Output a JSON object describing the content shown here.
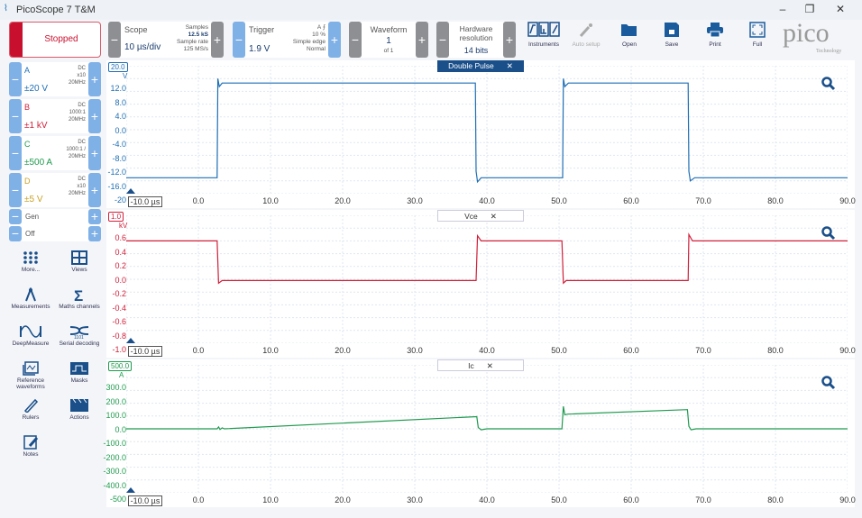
{
  "app": {
    "title": "PicoScope 7 T&M"
  },
  "toolbar": {
    "run_state": "Stopped",
    "scope": {
      "label": "Scope",
      "timebase": "10 µs/div",
      "samples_label": "Samples",
      "samples": "12.5 kS",
      "rate_label": "Sample rate",
      "rate": "125 MS/s"
    },
    "trigger": {
      "label": "Trigger",
      "level": "1.9 V",
      "source": "A",
      "position": "10 %",
      "type": "Simple edge",
      "mode": "Normal"
    },
    "waveform": {
      "label": "Waveform",
      "value": "1",
      "of": "of 1"
    },
    "resolution": {
      "label1": "Hardware",
      "label2": "resolution",
      "value": "14 bits"
    },
    "buttons": [
      "Instruments",
      "Auto setup",
      "Open",
      "Save",
      "Print",
      "Full"
    ],
    "logo": "pico",
    "logo_sub": "Technology"
  },
  "channels": [
    {
      "name": "A",
      "range": "±20 V",
      "coupling": "DC",
      "probe": "x10",
      "bw": "20MHz",
      "color": "#1f6fb5"
    },
    {
      "name": "B",
      "range": "±1 kV",
      "coupling": "DC",
      "probe": "1000:1",
      "bw": "20MHz",
      "color": "#d0203a"
    },
    {
      "name": "C",
      "range": "±500 A",
      "coupling": "DC",
      "probe": "1000:1 /",
      "bw": "20MHz",
      "color": "#1f9a4f"
    },
    {
      "name": "D",
      "range": "±5 V",
      "coupling": "DC",
      "probe": "x10",
      "bw": "20MHz",
      "color": "#c9a227"
    }
  ],
  "generator": {
    "label": "Gen",
    "state": "Off"
  },
  "side_tools": [
    "More...",
    "Views",
    "Measurements",
    "Maths channels",
    "DeepMeasure",
    "Serial decoding",
    "Reference waveforms",
    "Masks",
    "Rulers",
    "Actions",
    "Notes"
  ],
  "views": [
    {
      "tab": "Double Pulse",
      "unit": "V",
      "ref": "20.0",
      "color": "#1f6fb5",
      "yticks": [
        "12.0",
        "8.0",
        "4.0",
        "0.0",
        "-4.0",
        "-8.0",
        "-12.0",
        "-16.0",
        "-20"
      ],
      "ymin": -20,
      "ymax": 20,
      "points": [
        [
          -10,
          -15
        ],
        [
          2.6,
          -15
        ],
        [
          2.7,
          16
        ],
        [
          2.9,
          13.5
        ],
        [
          3.3,
          14.6
        ],
        [
          38.4,
          14.6
        ],
        [
          38.5,
          -13
        ],
        [
          38.7,
          -16.3
        ],
        [
          39.2,
          -15
        ],
        [
          50.5,
          -15
        ],
        [
          50.6,
          16
        ],
        [
          50.8,
          13.5
        ],
        [
          51.3,
          14.6
        ],
        [
          67.9,
          14.6
        ],
        [
          68,
          -13
        ],
        [
          68.2,
          -16
        ],
        [
          68.8,
          -15
        ],
        [
          90,
          -15
        ]
      ]
    },
    {
      "tab": "Vce",
      "unit": "kV",
      "ref": "1.0",
      "color": "#d0203a",
      "yticks": [
        "0.6",
        "0.4",
        "0.2",
        "0.0",
        "-0.2",
        "-0.4",
        "-0.6",
        "-0.8",
        "-1.0"
      ],
      "ymin": -1,
      "ymax": 1,
      "points": [
        [
          -10,
          0.6
        ],
        [
          2.6,
          0.6
        ],
        [
          2.8,
          -0.06
        ],
        [
          3.3,
          -0.02
        ],
        [
          38.5,
          -0.02
        ],
        [
          38.7,
          0.68
        ],
        [
          39.2,
          0.6
        ],
        [
          50.4,
          0.6
        ],
        [
          50.6,
          -0.06
        ],
        [
          51,
          -0.02
        ],
        [
          67.9,
          -0.02
        ],
        [
          68,
          0.7
        ],
        [
          68.5,
          0.6
        ],
        [
          90,
          0.6
        ]
      ]
    },
    {
      "tab": "Ic",
      "unit": "A",
      "ref": "500.0",
      "color": "#1f9a4f",
      "yticks": [
        "300.0",
        "200.0",
        "100.0",
        "0.0",
        "-100.0",
        "-200.0",
        "-300.0",
        "-400.0",
        "-500"
      ],
      "ymin": -500,
      "ymax": 500,
      "points": [
        [
          -10,
          0
        ],
        [
          2.6,
          0
        ],
        [
          2.8,
          15
        ],
        [
          3,
          -5
        ],
        [
          3.3,
          8
        ],
        [
          3.6,
          0
        ],
        [
          38.6,
          95
        ],
        [
          38.8,
          10
        ],
        [
          39.2,
          -8
        ],
        [
          40,
          0
        ],
        [
          50.4,
          0
        ],
        [
          50.6,
          175
        ],
        [
          50.8,
          110
        ],
        [
          51.2,
          115
        ],
        [
          67.8,
          150
        ],
        [
          68,
          20
        ],
        [
          68.3,
          -8
        ],
        [
          69,
          0
        ],
        [
          90,
          0
        ]
      ]
    }
  ],
  "xticks": [
    "-10.0 µs",
    "0.0",
    "10.0",
    "20.0",
    "30.0",
    "40.0",
    "50.0",
    "60.0",
    "70.0",
    "80.0",
    "90.0"
  ],
  "xmin": -10,
  "xmax": 90
}
